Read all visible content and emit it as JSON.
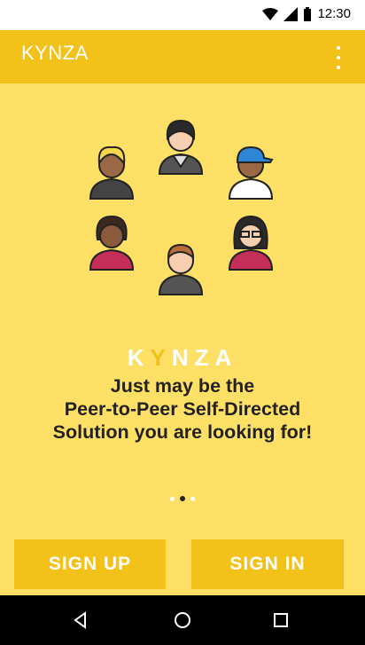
{
  "status_bar": {
    "time": "12:30"
  },
  "app_bar": {
    "title": "KYNZA"
  },
  "content": {
    "brand_parts": [
      "K",
      "Y",
      "NZA"
    ],
    "tagline_lines": [
      "Just may be the",
      "Peer-to-Peer Self-Directed",
      "Solution you are looking for!"
    ]
  },
  "buttons": {
    "sign_up": "SIGN UP",
    "sign_in": "SIGN IN"
  },
  "colors": {
    "background": "#FFE066",
    "accent": "#F2C21A",
    "text": "#222222"
  }
}
